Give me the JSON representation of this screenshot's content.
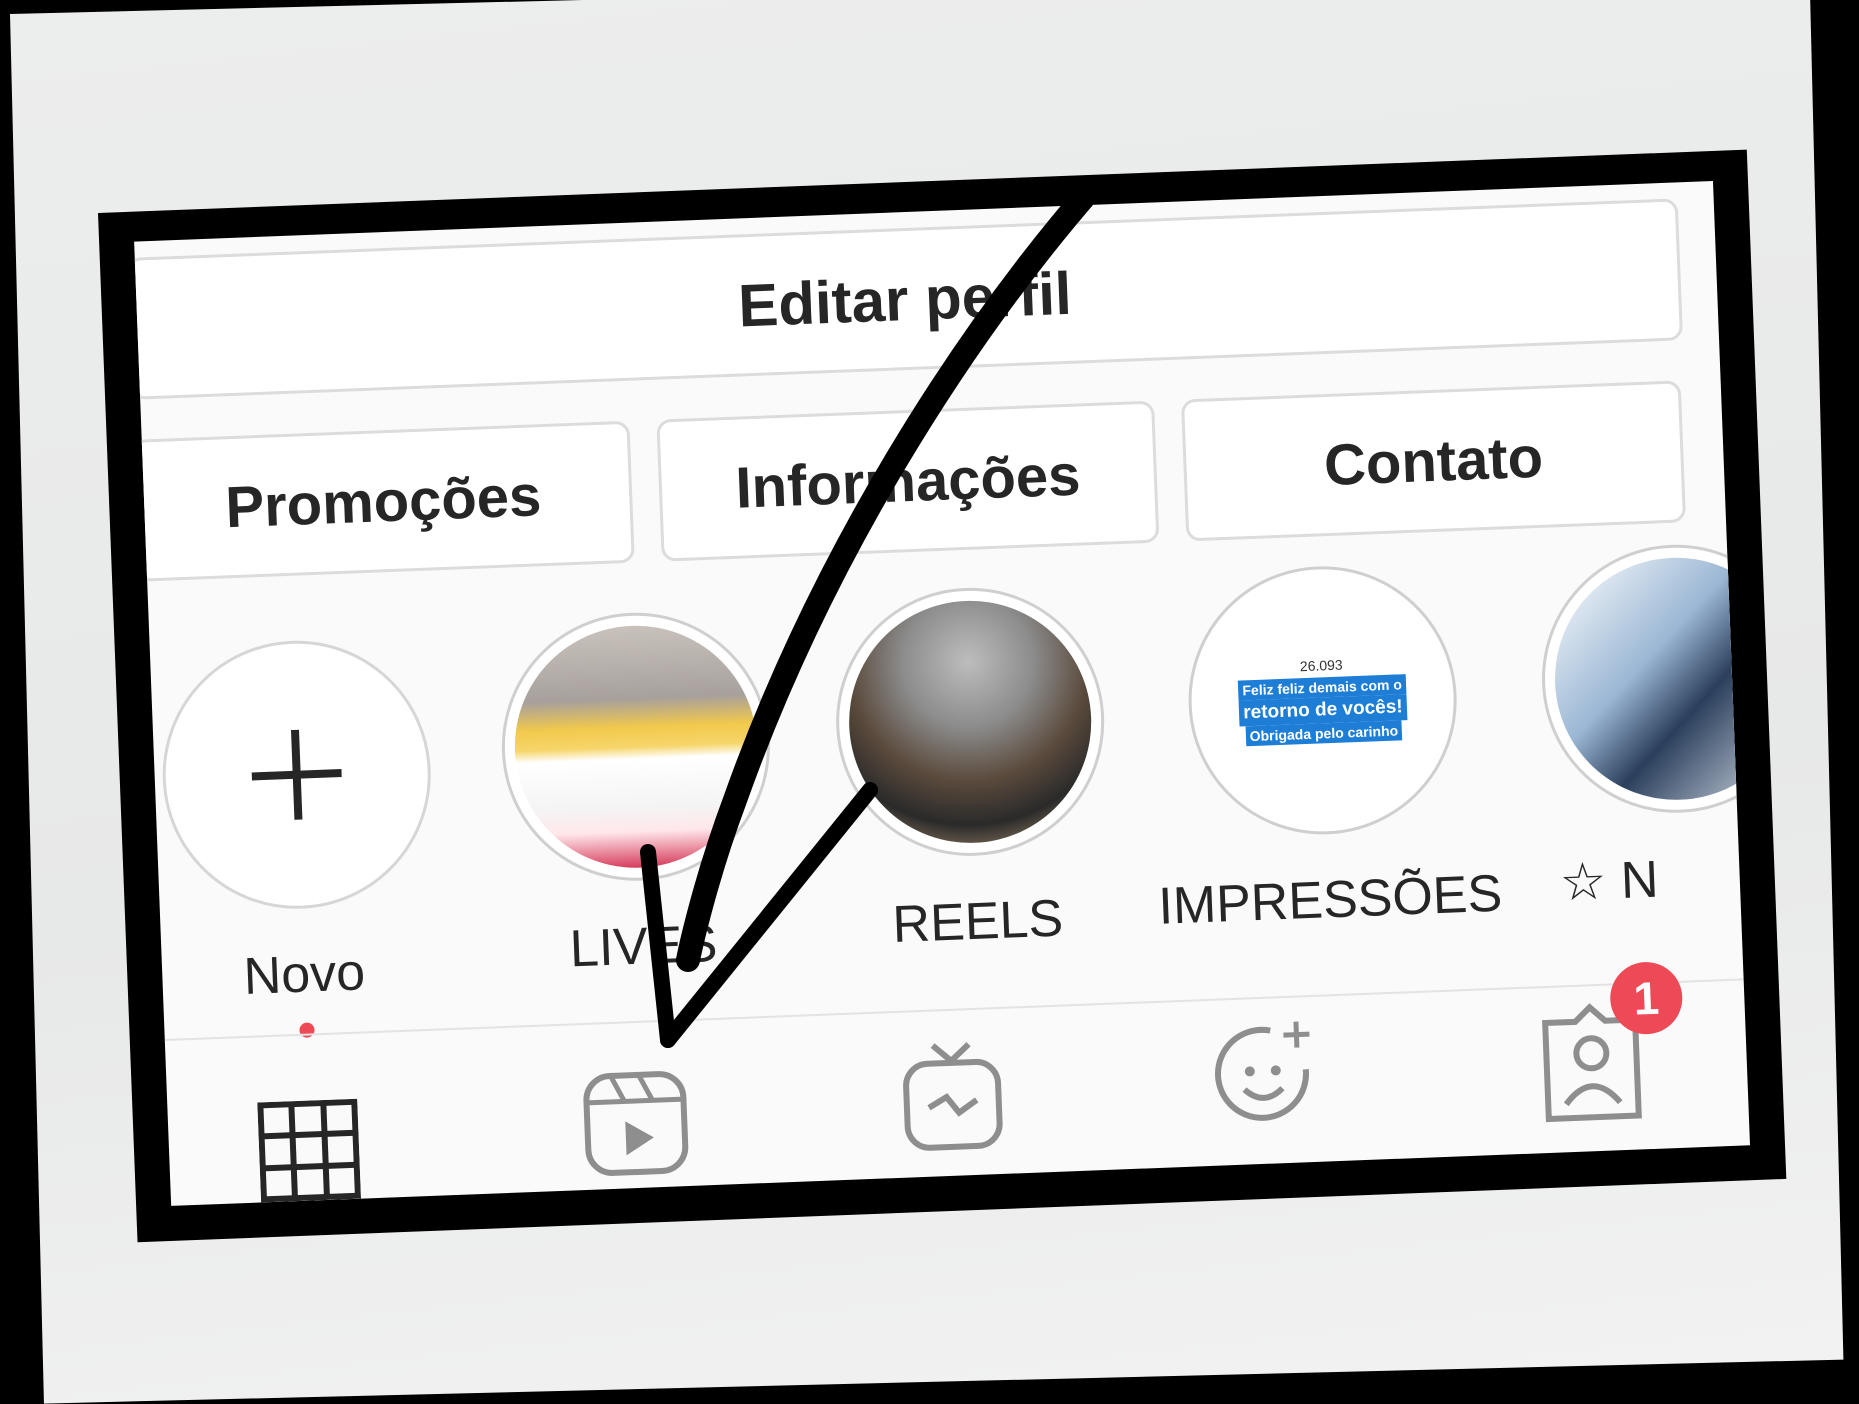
{
  "profile": {
    "edit_button": "Editar perfil",
    "actions": [
      "Promoções",
      "Informações",
      "Contato"
    ]
  },
  "highlights": [
    {
      "label": "Novo",
      "kind": "new",
      "icon": "plus-icon"
    },
    {
      "label": "LIVES",
      "kind": "image"
    },
    {
      "label": "REELS",
      "kind": "image"
    },
    {
      "label": "IMPRESSÕES",
      "kind": "image",
      "overlay_lines": [
        "26.093",
        "Feliz feliz demais com o",
        "retorno de vocês!",
        "Obrigada pelo carinho"
      ]
    },
    {
      "label": "☆ N",
      "kind": "image"
    }
  ],
  "new_indicator_color": "#ed4956",
  "tabs": [
    {
      "icon": "grid-icon"
    },
    {
      "icon": "reels-icon"
    },
    {
      "icon": "igtv-icon"
    },
    {
      "icon": "effects-icon"
    },
    {
      "icon": "tagged-icon",
      "badge": "1"
    }
  ],
  "colors": {
    "badge": "#ed4956",
    "text": "#262626",
    "overlay_blue": "#1e7ed6"
  }
}
